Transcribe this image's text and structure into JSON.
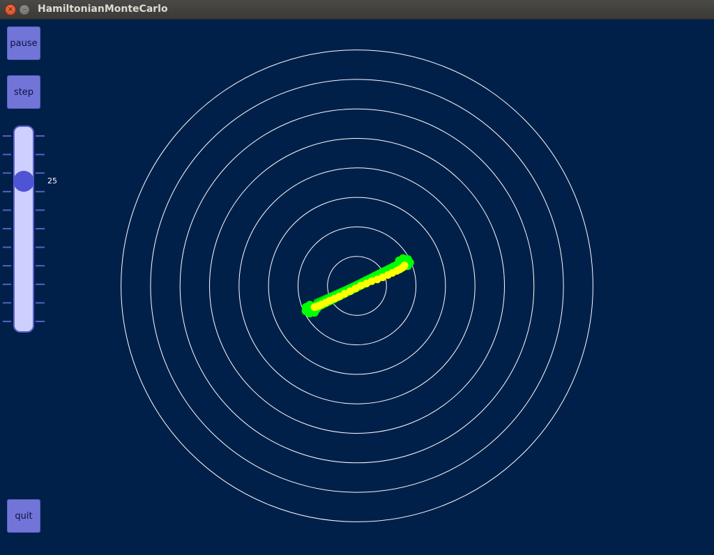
{
  "window": {
    "title": "HamiltonianMonteCarlo",
    "close_glyph": "×",
    "minimize_glyph": "–"
  },
  "controls": {
    "pause_label": "pause",
    "step_label": "step",
    "quit_label": "quit",
    "slider": {
      "value": "25",
      "level": 0.15
    }
  },
  "colors": {
    "background": "#00204a",
    "contour": "#ffffff",
    "trajectory_green": "#00ff00",
    "trajectory_yellow": "#ffff00",
    "button": "#7175d8",
    "slider_track": "#cdd0ff",
    "slider_knob": "#4e54d4"
  },
  "chart_data": {
    "type": "scatter",
    "contours": [
      1,
      2,
      3,
      4,
      5,
      6,
      7,
      8
    ],
    "center": [
      0,
      0
    ],
    "green_trajectory": {
      "start": [
        -1.56,
        -0.79
      ],
      "end": [
        1.6,
        0.79
      ]
    },
    "yellow_trajectory": [
      [
        -1.44,
        -0.72
      ],
      [
        -1.38,
        -0.71
      ],
      [
        -1.3,
        -0.68
      ],
      [
        -1.2,
        -0.63
      ],
      [
        -1.06,
        -0.57
      ],
      [
        -0.92,
        -0.5
      ],
      [
        -0.76,
        -0.43
      ],
      [
        -0.6,
        -0.36
      ],
      [
        -0.42,
        -0.27
      ],
      [
        -0.23,
        -0.18
      ],
      [
        -0.05,
        -0.09
      ],
      [
        0.13,
        0.01
      ],
      [
        0.32,
        0.08
      ],
      [
        0.5,
        0.16
      ],
      [
        0.69,
        0.22
      ],
      [
        0.87,
        0.29
      ],
      [
        1.05,
        0.37
      ],
      [
        1.2,
        0.44
      ],
      [
        1.35,
        0.51
      ],
      [
        1.45,
        0.56
      ],
      [
        1.53,
        0.61
      ],
      [
        1.57,
        0.64
      ],
      [
        1.6,
        0.67
      ],
      [
        1.61,
        0.69
      ]
    ]
  }
}
